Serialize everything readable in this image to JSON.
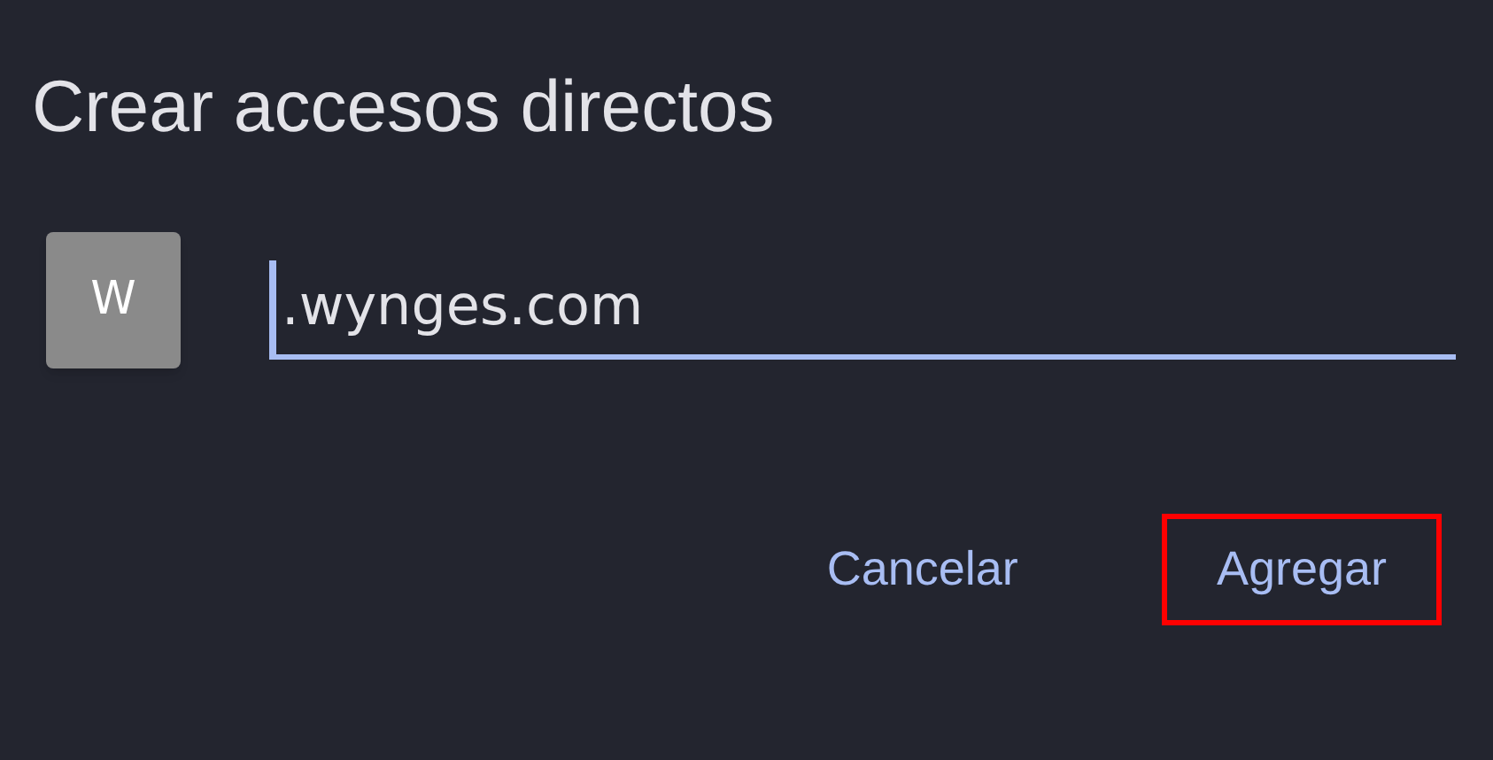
{
  "dialog": {
    "title": "Crear accesos directos"
  },
  "shortcut": {
    "tile_letter": "W",
    "url_field": {
      "value": ".wynges.com",
      "focused": true
    }
  },
  "buttons": [
    {
      "label": "Cancelar",
      "highlighted": false
    },
    {
      "label": "Agregar",
      "highlighted": true
    }
  ]
}
